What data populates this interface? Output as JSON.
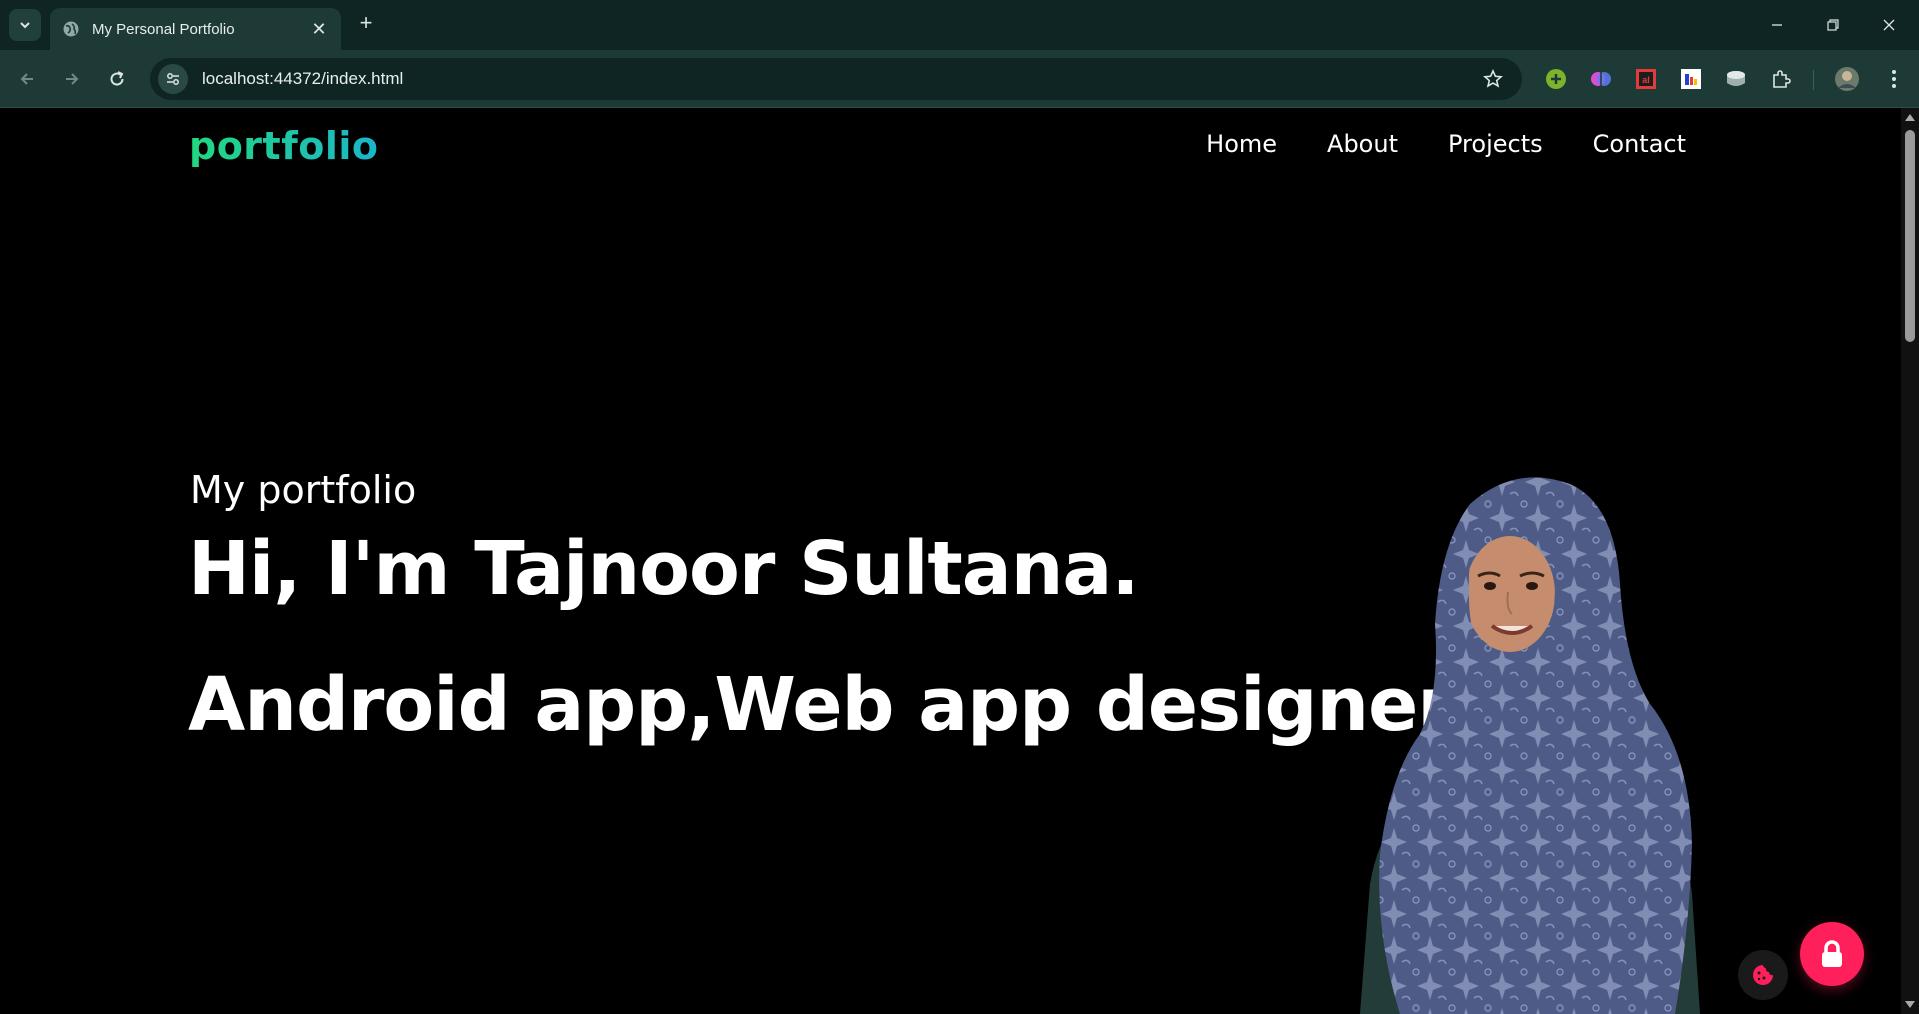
{
  "browser": {
    "tab": {
      "title": "My Personal Portfolio",
      "favicon": "globe-icon"
    },
    "address_bar": {
      "url": "localhost:44372/index.html"
    },
    "extensions": [
      "green-plus-extension-icon",
      "brain-extension-icon",
      "pdf-extension-icon",
      "chart-extension-icon",
      "database-extension-icon",
      "puzzle-extensions-icon"
    ],
    "colors": {
      "frame": "#0f2523",
      "toolbar": "#1d3a37"
    }
  },
  "site": {
    "logo": "portfolio",
    "nav": [
      {
        "label": "Home"
      },
      {
        "label": "About"
      },
      {
        "label": "Projects"
      },
      {
        "label": "Contact"
      }
    ],
    "hero": {
      "eyebrow": "My portfolio",
      "headline": "Hi, I'm Tajnoor Sultana.",
      "tagline": "Android app,Web app designer"
    },
    "colors": {
      "accent_green": "#22d87f",
      "accent_teal": "#1bb5c9",
      "lock_button": "#ff1f5a",
      "background": "#000000"
    }
  }
}
